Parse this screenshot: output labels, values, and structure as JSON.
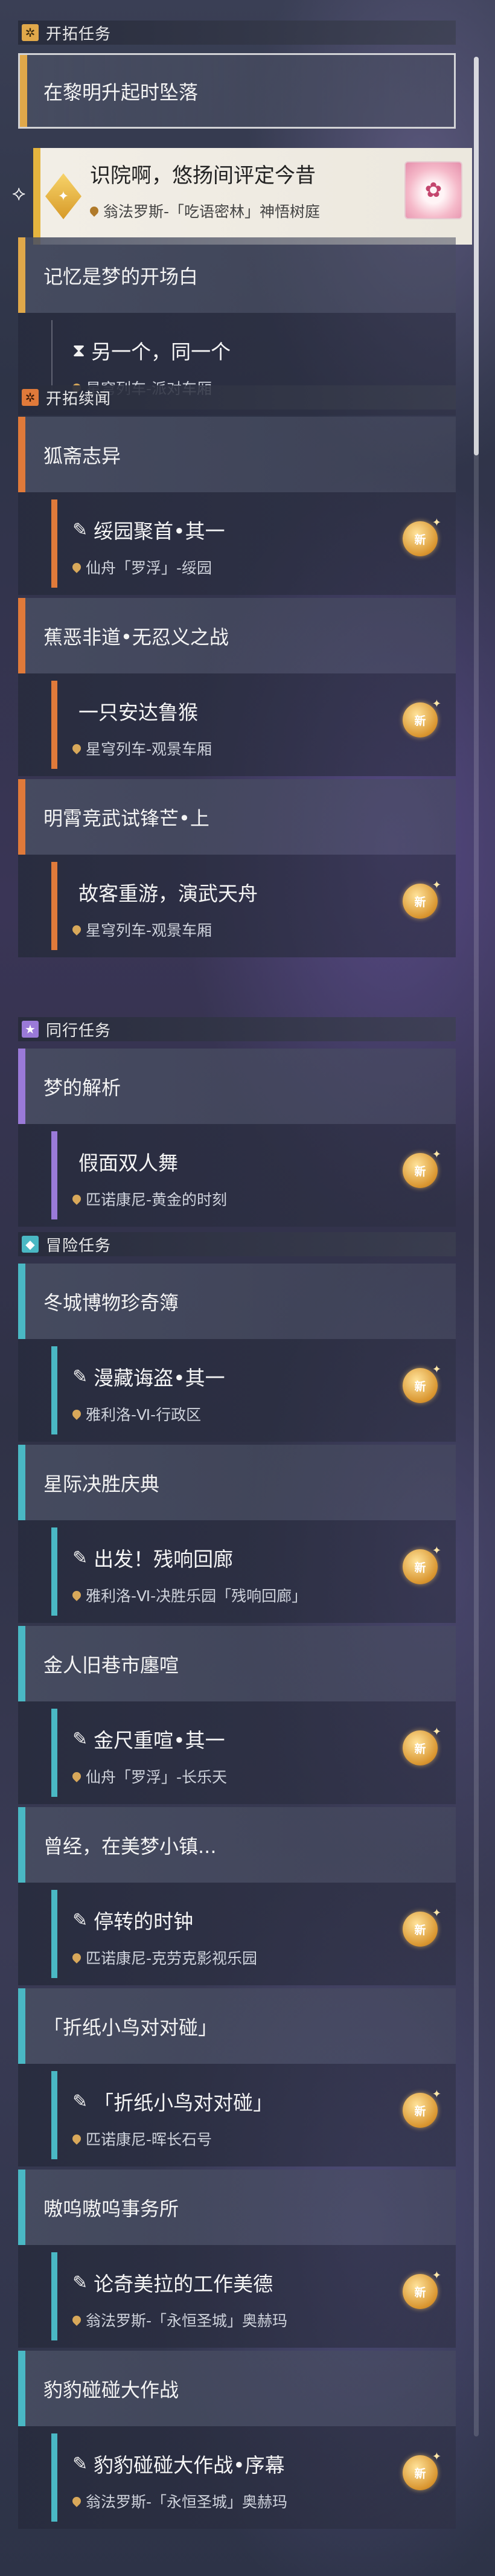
{
  "new_badge_label": "新",
  "sections": {
    "main": {
      "title": "开拓任务",
      "icon": "✲",
      "color": "#e0a84a"
    },
    "continued": {
      "title": "开拓续闻",
      "icon": "✲",
      "color": "#e07a3a"
    },
    "companion": {
      "title": "同行任务",
      "icon": "★",
      "color": "#9a7ad8"
    },
    "adventure": {
      "title": "冒险任务",
      "icon": "◆",
      "color": "#4ab8c4"
    }
  },
  "main_quests": [
    {
      "title": "在黎明升起时坠落",
      "active": true
    },
    {
      "title": "记忆是梦的开场白"
    }
  ],
  "selected_child": {
    "title": "识院啊，悠扬间评定今昔",
    "location": "翁法罗斯-「吃语密林」神悟树庭"
  },
  "main_child_2": {
    "title": "另一个，同一个",
    "location": "星穹列车-派对车厢",
    "icon": "⧗"
  },
  "continued": [
    {
      "title": "狐斋志异",
      "child": "绥园聚首•其一",
      "location": "仙舟「罗浮」-绥园",
      "icon": "✎"
    },
    {
      "title": "蕉恶非道•无忍义之战",
      "child": "一只安达鲁猴",
      "location": "星穹列车-观景车厢",
      "icon": ""
    },
    {
      "title": "明霄竞武试锋芒•上",
      "child": "故客重游，演武天舟",
      "location": "星穹列车-观景车厢",
      "icon": ""
    }
  ],
  "companion": [
    {
      "title": "梦的解析",
      "child": "假面双人舞",
      "location": "匹诺康尼-黄金的时刻",
      "icon": ""
    }
  ],
  "adventure": [
    {
      "title": "冬城博物珍奇簿",
      "child": "漫藏诲盗•其一",
      "location": "雅利洛-Ⅵ-行政区",
      "icon": "✎"
    },
    {
      "title": "星际决胜庆典",
      "child": "出发！残响回廊",
      "location": "雅利洛-Ⅵ-决胜乐园「残响回廊」",
      "icon": "✎"
    },
    {
      "title": "金人旧巷市廛喧",
      "child": "金尺重喧•其一",
      "location": "仙舟「罗浮」-长乐天",
      "icon": "✎"
    },
    {
      "title": "曾经，在美梦小镇...",
      "child": "停转的时钟",
      "location": "匹诺康尼-克劳克影视乐园",
      "icon": "✎"
    },
    {
      "title": "「折纸小鸟对对碰」",
      "child": "「折纸小鸟对对碰」",
      "location": "匹诺康尼-晖长石号",
      "icon": "✎"
    },
    {
      "title": "嗷呜嗷呜事务所",
      "child": "论奇美拉的工作美德",
      "location": "翁法罗斯-「永恒圣城」奥赫玛",
      "icon": "✎"
    },
    {
      "title": "豹豹碰碰大作战",
      "child": "豹豹碰碰大作战•序幕",
      "location": "翁法罗斯-「永恒圣城」奥赫玛",
      "icon": "✎"
    }
  ]
}
